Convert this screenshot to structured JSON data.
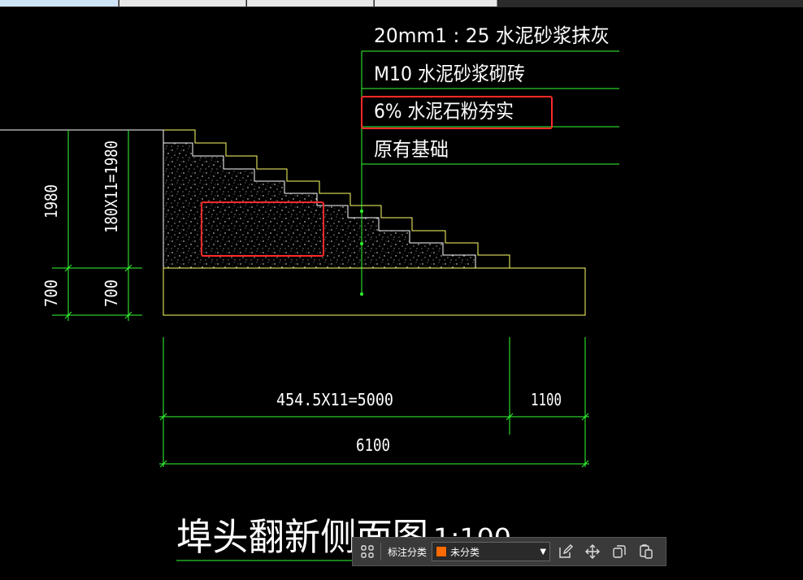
{
  "colors": {
    "background": "#000000",
    "outline_yellow": "#ffff66",
    "dimension_green": "#33ff33",
    "highlight_red": "#ff2a2a",
    "swatch_orange": "#ff6a00"
  },
  "cad": {
    "legend": {
      "line1": "20mm1    : 25  水泥砂浆抹灰",
      "line2": "M10  水泥砂浆砌砖",
      "line3": "6% 水泥石粉夯实",
      "line4": "原有基础"
    },
    "dims": {
      "left_total": "1980",
      "left_steps": "180X11=1980",
      "left_base": "700",
      "left_base2": "700",
      "bottom_steps": "454.5X11=5000",
      "bottom_right": "1100",
      "bottom_total": "6100"
    },
    "title": "埠头翻新侧面图",
    "scale": "1:100"
  },
  "toolbar": {
    "grid_icon": "grid-icon",
    "category_label": "标注分类",
    "category_value": "未分类",
    "edit_icon": "edit-icon",
    "move_icon": "move-icon",
    "copy_icon": "copy-icon",
    "paste_icon": "paste-icon"
  }
}
